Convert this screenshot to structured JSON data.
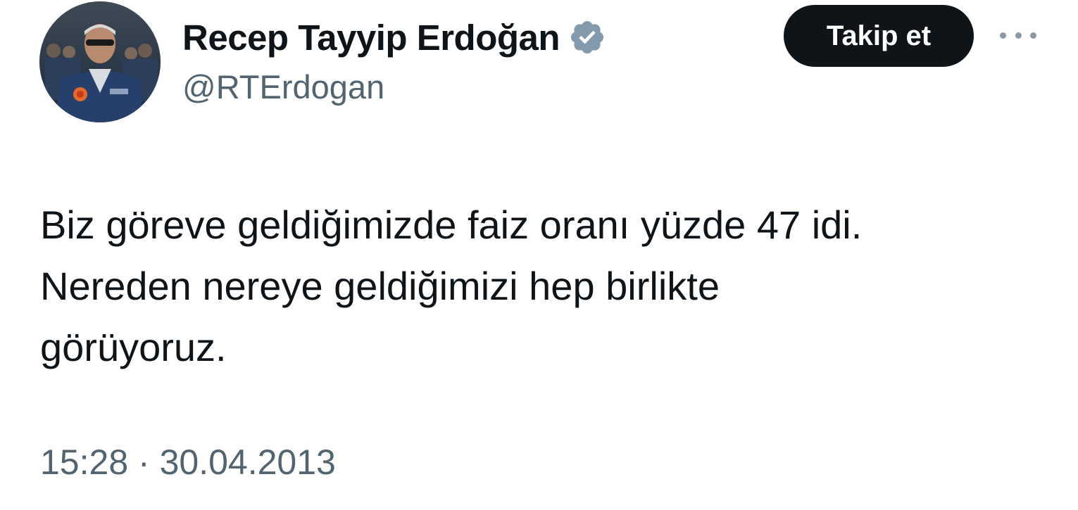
{
  "author": {
    "display_name": "Recep Tayyip Erdoğan",
    "handle": "@RTErdogan",
    "verified": true,
    "verified_badge_color": "#829aab"
  },
  "actions": {
    "follow_label": "Takip et",
    "more_icon": "more-horizontal-icon"
  },
  "tweet": {
    "text": "Biz göreve geldiğimizde faiz oranı yüzde 47 idi.\nNereden nereye geldiğimizi hep birlikte\ngörüyoruz."
  },
  "meta": {
    "time": "15:28",
    "separator": "·",
    "date": "30.04.2013"
  }
}
